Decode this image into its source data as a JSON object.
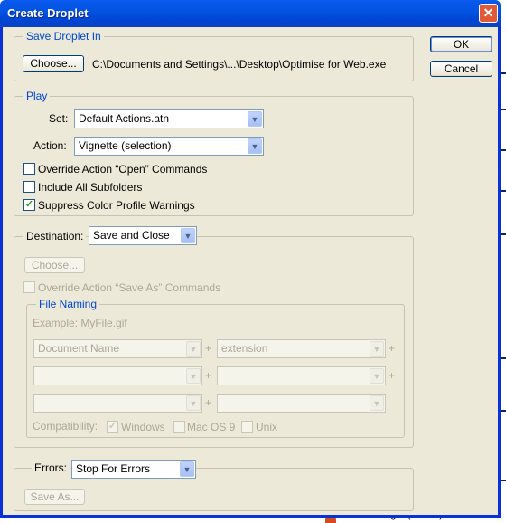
{
  "window": {
    "title": "Create Droplet",
    "close_glyph": "✕"
  },
  "buttons": {
    "ok": "OK",
    "cancel": "Cancel"
  },
  "save_droplet": {
    "legend": "Save Droplet In",
    "choose_label": "Choose...",
    "path": "C:\\Documents and Settings\\...\\Desktop\\Optimise for Web.exe"
  },
  "play": {
    "legend": "Play",
    "set_label": "Set:",
    "set_value": "Default Actions.atn",
    "action_label": "Action:",
    "action_value": "Vignette (selection)",
    "override_open": {
      "label": "Override Action “Open” Commands",
      "checked": false
    },
    "include_subfolders": {
      "label": "Include All Subfolders",
      "checked": false
    },
    "suppress_warnings": {
      "label": "Suppress Color Profile Warnings",
      "checked": true
    }
  },
  "destination": {
    "label": "Destination:",
    "value": "Save and Close",
    "choose_label": "Choose...",
    "override_save": {
      "label": "Override Action “Save As” Commands",
      "checked": false
    },
    "file_naming": {
      "legend": "File Naming",
      "example": "Example: MyFile.gif",
      "rows": [
        {
          "left": "Document Name",
          "right": "extension"
        },
        {
          "left": "",
          "right": ""
        },
        {
          "left": "",
          "right": ""
        }
      ],
      "plus": "+",
      "compatibility_label": "Compatibility:",
      "windows": {
        "label": "Windows",
        "checked": true
      },
      "macos": {
        "label": "Mac OS 9",
        "checked": false
      },
      "unix": {
        "label": "Unix",
        "checked": false
      }
    }
  },
  "errors": {
    "label": "Errors:",
    "value": "Stop For Errors",
    "save_as_label": "Save As..."
  },
  "background": {
    "bottom_text": "Color Target (Button)"
  },
  "colors": {
    "accent": "#0046d5",
    "titlebar": "#0054e3",
    "face": "#ece9d8"
  }
}
